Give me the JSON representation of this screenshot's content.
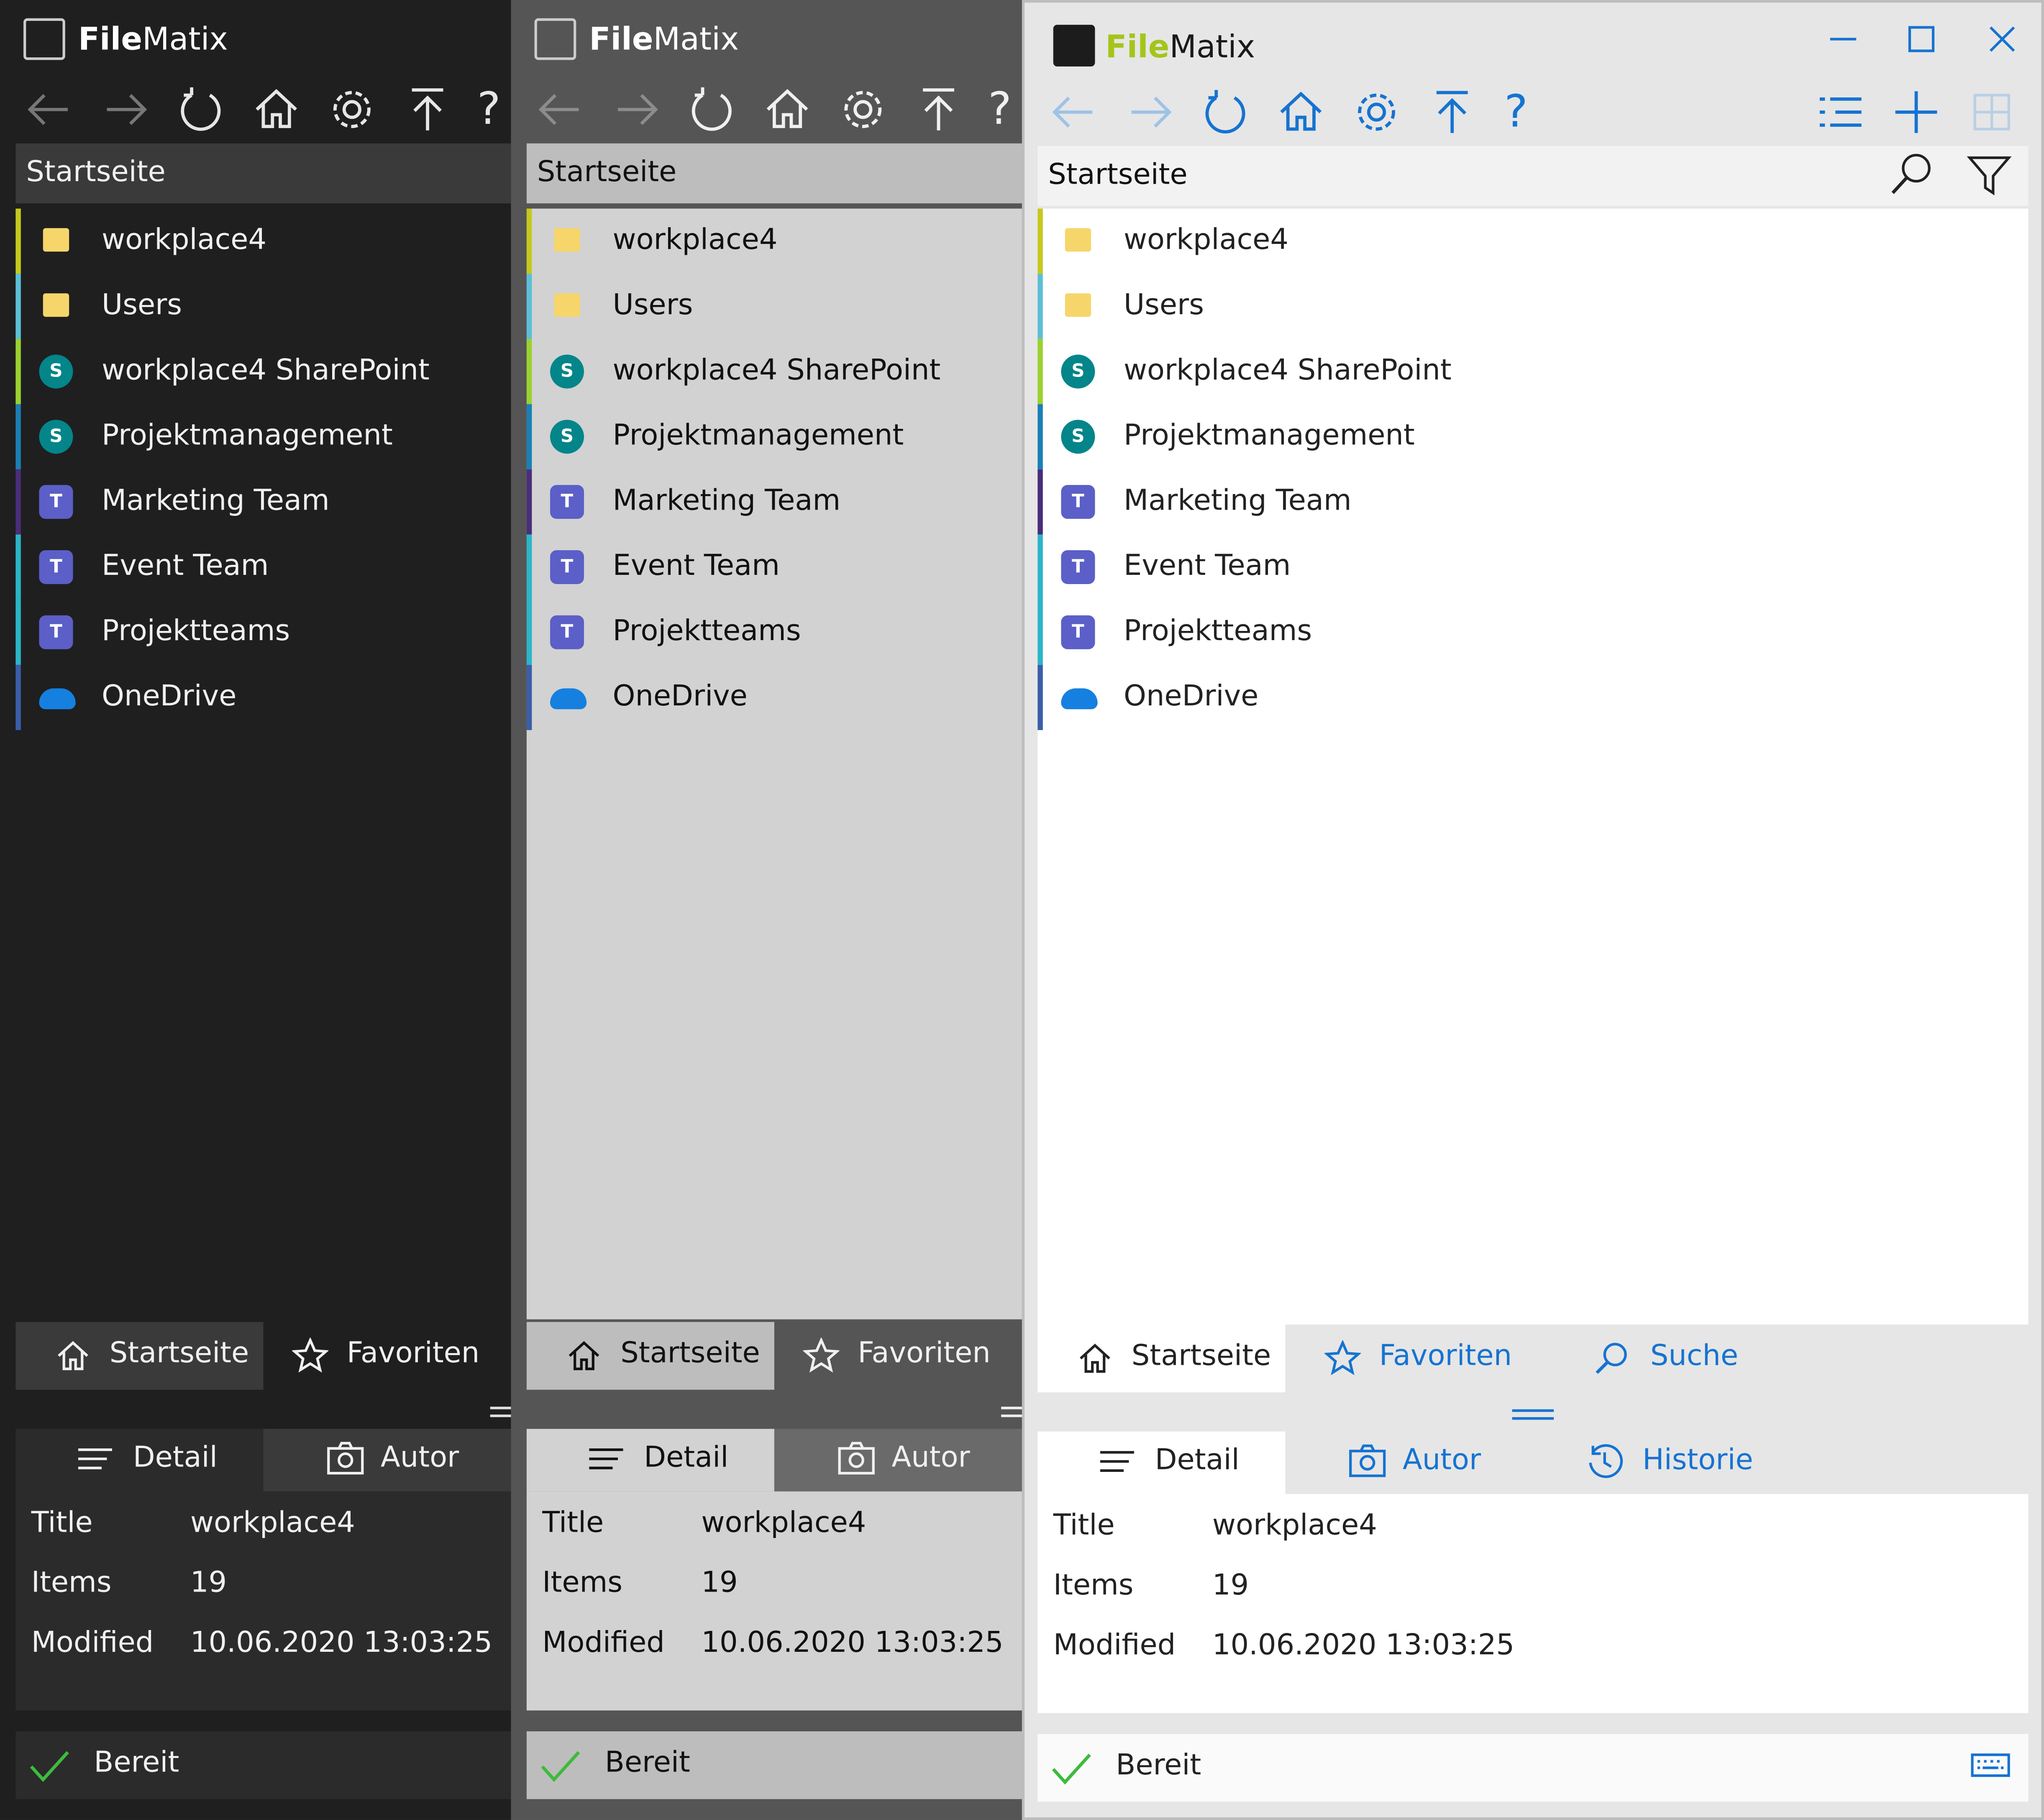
{
  "app": {
    "title_bold": "File",
    "title_rest": "Matix"
  },
  "header": {
    "title": "Startseite"
  },
  "items": [
    {
      "label": "workplace4",
      "icon": "folder-icon",
      "color": "#c5c91c"
    },
    {
      "label": "Users",
      "icon": "folder-icon",
      "color": "#5bbfd6"
    },
    {
      "label": "workplace4 SharePoint",
      "icon": "sharepoint-icon",
      "color": "#9ad12f"
    },
    {
      "label": "Projektmanagement",
      "icon": "sharepoint-icon",
      "color": "#1b7fb5"
    },
    {
      "label": "Marketing Team",
      "icon": "teams-icon",
      "color": "#4a2d7a"
    },
    {
      "label": "Event Team",
      "icon": "teams-icon",
      "color": "#2bb5c8"
    },
    {
      "label": "Projektteams",
      "icon": "teams-icon",
      "color": "#2bb5c8"
    },
    {
      "label": "OneDrive",
      "icon": "onedrive-icon",
      "color": "#3a5ea8"
    }
  ],
  "nav_tabs": {
    "home": "Startseite",
    "favorites": "Favoriten",
    "search": "Suche"
  },
  "detail_tabs": {
    "detail": "Detail",
    "author": "Autor",
    "history": "Historie"
  },
  "details": {
    "title_label": "Title",
    "title_value": "workplace4",
    "items_label": "Items",
    "items_value": "19",
    "modified_label": "Modified",
    "modified_value": "10.06.2020 13:03:25"
  },
  "status": {
    "text": "Bereit"
  },
  "toolbar": {
    "help_label": "?"
  },
  "colors": {
    "accent_blue": "#1673d1",
    "brand_green": "#a4c51a",
    "check_green": "#3dbb3d"
  }
}
